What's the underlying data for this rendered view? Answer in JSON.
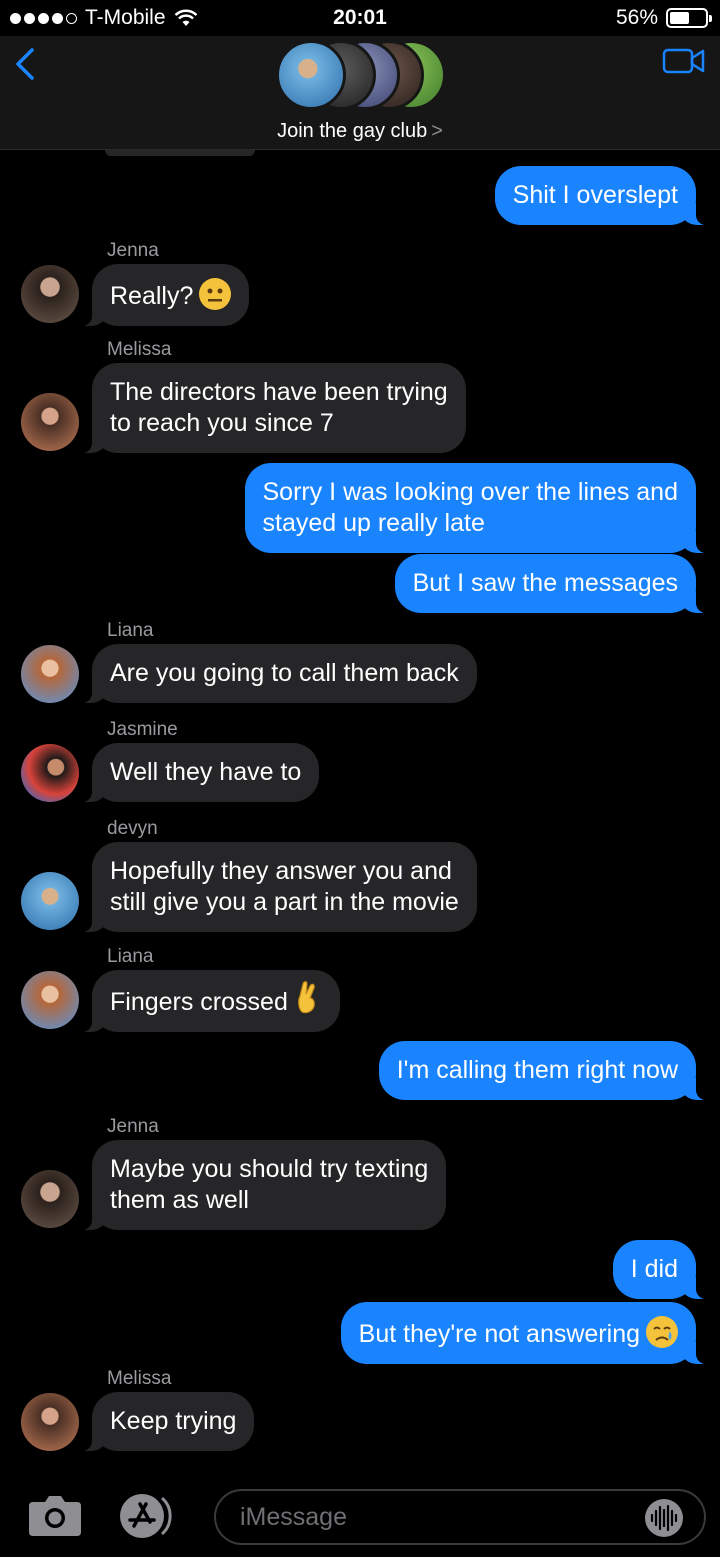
{
  "status_bar": {
    "carrier": "T-Mobile",
    "time": "20:01",
    "battery": "56%",
    "battery_level": 0.56,
    "signal_bars": 4
  },
  "header": {
    "group_name": "Join the gay club",
    "chevron": ">",
    "back_icon": "chevron-left-icon",
    "video_icon": "video-camera-icon",
    "avatar_colors": [
      "#4f8fc2",
      "#2b2b2b",
      "#5a6fa5",
      "#3d3d3d",
      "#4d9a3a"
    ]
  },
  "messages": [
    {
      "side": "out",
      "text": "Shit I overslept"
    },
    {
      "side": "in",
      "sender": "Jenna",
      "text": "Really?",
      "emoji": "neutral-face-emoji"
    },
    {
      "side": "in",
      "sender": "Melissa",
      "lines": [
        "The directors have been trying",
        "to reach you since 7"
      ]
    },
    {
      "side": "out",
      "lines": [
        "Sorry I was looking over the lines and",
        "stayed up really late"
      ]
    },
    {
      "side": "out",
      "text": "But I saw the messages"
    },
    {
      "side": "in",
      "sender": "Liana",
      "text": "Are you going to call them back"
    },
    {
      "side": "in",
      "sender": "Jasmine",
      "text": "Well they have to"
    },
    {
      "side": "in",
      "sender": "devyn",
      "lines": [
        "Hopefully they answer you and",
        "still give you a part in the movie"
      ]
    },
    {
      "side": "in",
      "sender": "Liana",
      "text": "Fingers crossed",
      "emoji": "crossed-fingers-emoji"
    },
    {
      "side": "out",
      "text": "I'm calling them right now"
    },
    {
      "side": "in",
      "sender": "Jenna",
      "lines": [
        "Maybe you should try texting",
        "them as well"
      ]
    },
    {
      "side": "out",
      "text": "I did"
    },
    {
      "side": "out",
      "text": "But they're not answering",
      "emoji": "crying-face-emoji"
    },
    {
      "side": "in",
      "sender": "Melissa",
      "text": "Keep trying"
    }
  ],
  "input_bar": {
    "placeholder": "iMessage",
    "camera_icon": "camera-icon",
    "appstore_icon": "app-store-icon",
    "audio_icon": "audio-waveform-icon"
  },
  "colors": {
    "background": "#000000",
    "incoming_bubble": "#262628",
    "outgoing_bubble": "#1a84ff",
    "accent": "#1a84ff",
    "sender_label": "#9a9a9f"
  }
}
